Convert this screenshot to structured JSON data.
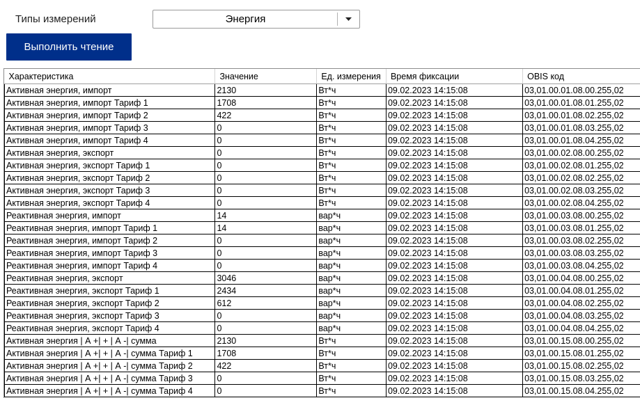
{
  "controls": {
    "measurement_types_label": "Типы измерений",
    "measurement_type_value": "Энергия",
    "read_button_label": "Выполнить чтение"
  },
  "table": {
    "columns": [
      "Характеристика",
      "Значение",
      "Ед. измерения",
      "Время фиксации",
      "OBIS код"
    ],
    "rows": [
      [
        "Активная энергия, импорт",
        "2130",
        "Вт*ч",
        "09.02.2023 14:15:08",
        "03,01.00.01.08.00.255,02"
      ],
      [
        "Активная энергия, импорт Тариф 1",
        "1708",
        "Вт*ч",
        "09.02.2023 14:15:08",
        "03,01.00.01.08.01.255,02"
      ],
      [
        "Активная энергия, импорт Тариф 2",
        "422",
        "Вт*ч",
        "09.02.2023 14:15:08",
        "03,01.00.01.08.02.255,02"
      ],
      [
        "Активная энергия, импорт Тариф 3",
        "0",
        "Вт*ч",
        "09.02.2023 14:15:08",
        "03,01.00.01.08.03.255,02"
      ],
      [
        "Активная энергия, импорт Тариф 4",
        "0",
        "Вт*ч",
        "09.02.2023 14:15:08",
        "03,01.00.01.08.04.255,02"
      ],
      [
        "Активная энергия, экспорт",
        "0",
        "Вт*ч",
        "09.02.2023 14:15:08",
        "03,01.00.02.08.00.255,02"
      ],
      [
        "Активная энергия, экспорт Тариф 1",
        "0",
        "Вт*ч",
        "09.02.2023 14:15:08",
        "03,01.00.02.08.01.255,02"
      ],
      [
        "Активная энергия, экспорт Тариф 2",
        "0",
        "Вт*ч",
        "09.02.2023 14:15:08",
        "03,01.00.02.08.02.255,02"
      ],
      [
        "Активная энергия, экспорт Тариф 3",
        "0",
        "Вт*ч",
        "09.02.2023 14:15:08",
        "03,01.00.02.08.03.255,02"
      ],
      [
        "Активная энергия, экспорт Тариф 4",
        "0",
        "Вт*ч",
        "09.02.2023 14:15:08",
        "03,01.00.02.08.04.255,02"
      ],
      [
        "Реактивная  энергия, импорт",
        "14",
        "вар*ч",
        "09.02.2023 14:15:08",
        "03,01.00.03.08.00.255,02"
      ],
      [
        "Реактивная  энергия, импорт Тариф 1",
        "14",
        "вар*ч",
        "09.02.2023 14:15:08",
        "03,01.00.03.08.01.255,02"
      ],
      [
        "Реактивная  энергия, импорт Тариф 2",
        "0",
        "вар*ч",
        "09.02.2023 14:15:08",
        "03,01.00.03.08.02.255,02"
      ],
      [
        "Реактивная  энергия, импорт Тариф 3",
        "0",
        "вар*ч",
        "09.02.2023 14:15:08",
        "03,01.00.03.08.03.255,02"
      ],
      [
        "Реактивная  энергия, импорт Тариф 4",
        "0",
        "вар*ч",
        "09.02.2023 14:15:08",
        "03,01.00.03.08.04.255,02"
      ],
      [
        "Реактивная энергия, экспорт",
        "3046",
        "вар*ч",
        "09.02.2023 14:15:08",
        "03,01.00.04.08.00.255,02"
      ],
      [
        "Реактивная энергия, экспорт Тариф 1",
        "2434",
        "вар*ч",
        "09.02.2023 14:15:08",
        "03,01.00.04.08.01.255,02"
      ],
      [
        "Реактивная энергия, экспорт Тариф 2",
        "612",
        "вар*ч",
        "09.02.2023 14:15:08",
        "03,01.00.04.08.02.255,02"
      ],
      [
        "Реактивная энергия, экспорт Тариф 3",
        "0",
        "вар*ч",
        "09.02.2023 14:15:08",
        "03,01.00.04.08.03.255,02"
      ],
      [
        "Реактивная энергия, экспорт Тариф 4",
        "0",
        "вар*ч",
        "09.02.2023 14:15:08",
        "03,01.00.04.08.04.255,02"
      ],
      [
        "Активная энергия | А +| + | А -| сумма",
        "2130",
        "Вт*ч",
        "09.02.2023 14:15:08",
        "03,01.00.15.08.00.255,02"
      ],
      [
        "Активная энергия | А +| + | А -| сумма Тариф 1",
        "1708",
        "Вт*ч",
        "09.02.2023 14:15:08",
        "03,01.00.15.08.01.255,02"
      ],
      [
        "Активная энергия | А +| + | А -| сумма Тариф 2",
        "422",
        "Вт*ч",
        "09.02.2023 14:15:08",
        "03,01.00.15.08.02.255,02"
      ],
      [
        "Активная энергия | А +| + | А -| сумма Тариф 3",
        "0",
        "Вт*ч",
        "09.02.2023 14:15:08",
        "03,01.00.15.08.03.255,02"
      ],
      [
        "Активная энергия | А +| + | А -| сумма Тариф 4",
        "0",
        "Вт*ч",
        "09.02.2023 14:15:08",
        "03,01.00.15.08.04.255,02"
      ]
    ]
  },
  "colors": {
    "button_bg": "#002f8a",
    "button_text": "#ffffff",
    "grid_line": "#000000"
  },
  "icons": {
    "dropdown": "chevron-down-icon"
  }
}
